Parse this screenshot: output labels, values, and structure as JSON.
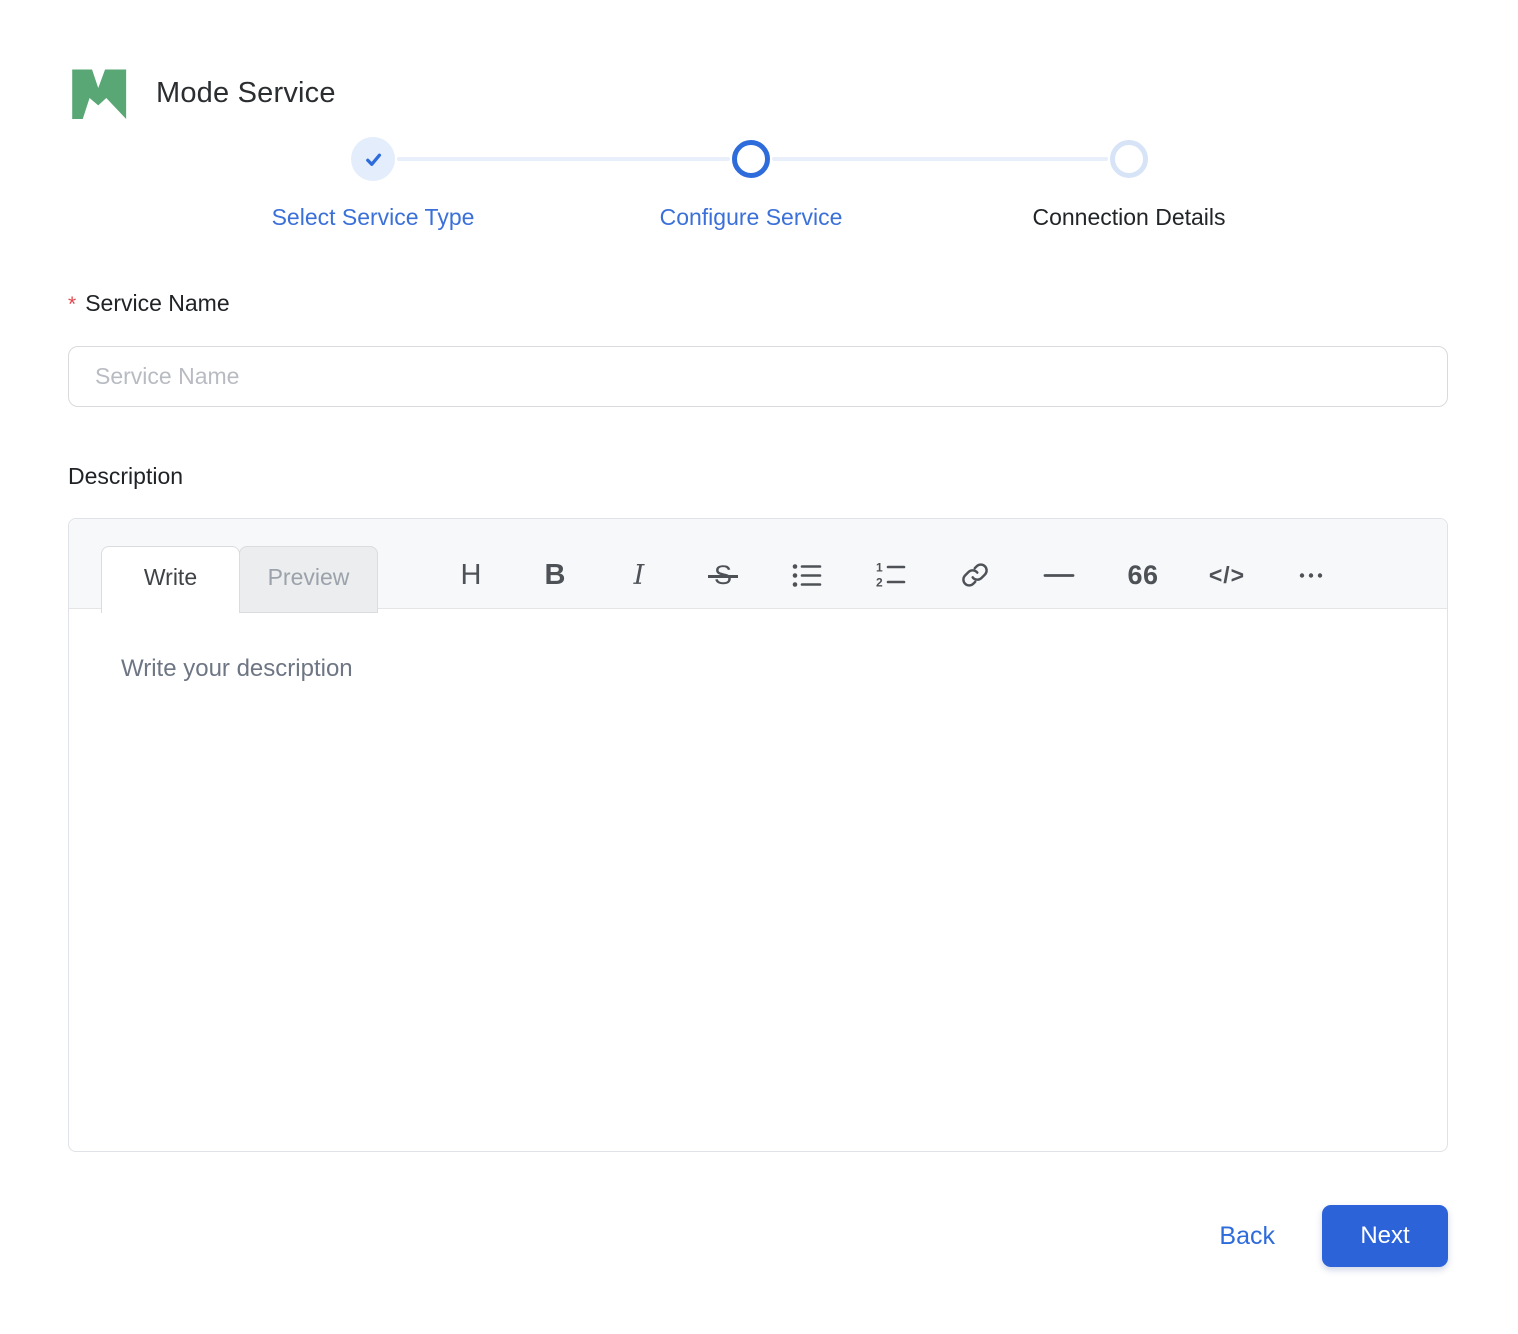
{
  "brand": {
    "name": "Mode Service"
  },
  "stepper": {
    "steps": [
      {
        "label": "Select Service Type",
        "state": "completed"
      },
      {
        "label": "Configure Service",
        "state": "active"
      },
      {
        "label": "Connection Details",
        "state": "upcoming"
      }
    ]
  },
  "form": {
    "service_name": {
      "label": "Service Name",
      "required_marker": "*",
      "placeholder": "Service Name",
      "value": ""
    },
    "description": {
      "label": "Description",
      "placeholder": "Write your description",
      "value": ""
    }
  },
  "editor": {
    "tabs": [
      {
        "label": "Write"
      },
      {
        "label": "Preview"
      }
    ],
    "active_tab": "Write",
    "toolbar": [
      {
        "name": "heading",
        "glyph": "H"
      },
      {
        "name": "bold",
        "glyph": "B"
      },
      {
        "name": "italic",
        "glyph": "I"
      },
      {
        "name": "strikethrough",
        "glyph": "S"
      },
      {
        "name": "unordered-list"
      },
      {
        "name": "ordered-list"
      },
      {
        "name": "link"
      },
      {
        "name": "horizontal-rule"
      },
      {
        "name": "quote",
        "glyph": "66"
      },
      {
        "name": "code",
        "glyph": "&lt;/&gt;"
      },
      {
        "name": "more"
      }
    ]
  },
  "footer": {
    "back_label": "Back",
    "next_label": "Next"
  },
  "colors": {
    "accent_blue": "#2e6bdb",
    "logo_green": "#58a775",
    "required_red": "#e5484d",
    "next_button_blue": "#2d63d9",
    "step_upcoming_ring": "#d7e3f6",
    "connector_line": "#e8eefa"
  }
}
